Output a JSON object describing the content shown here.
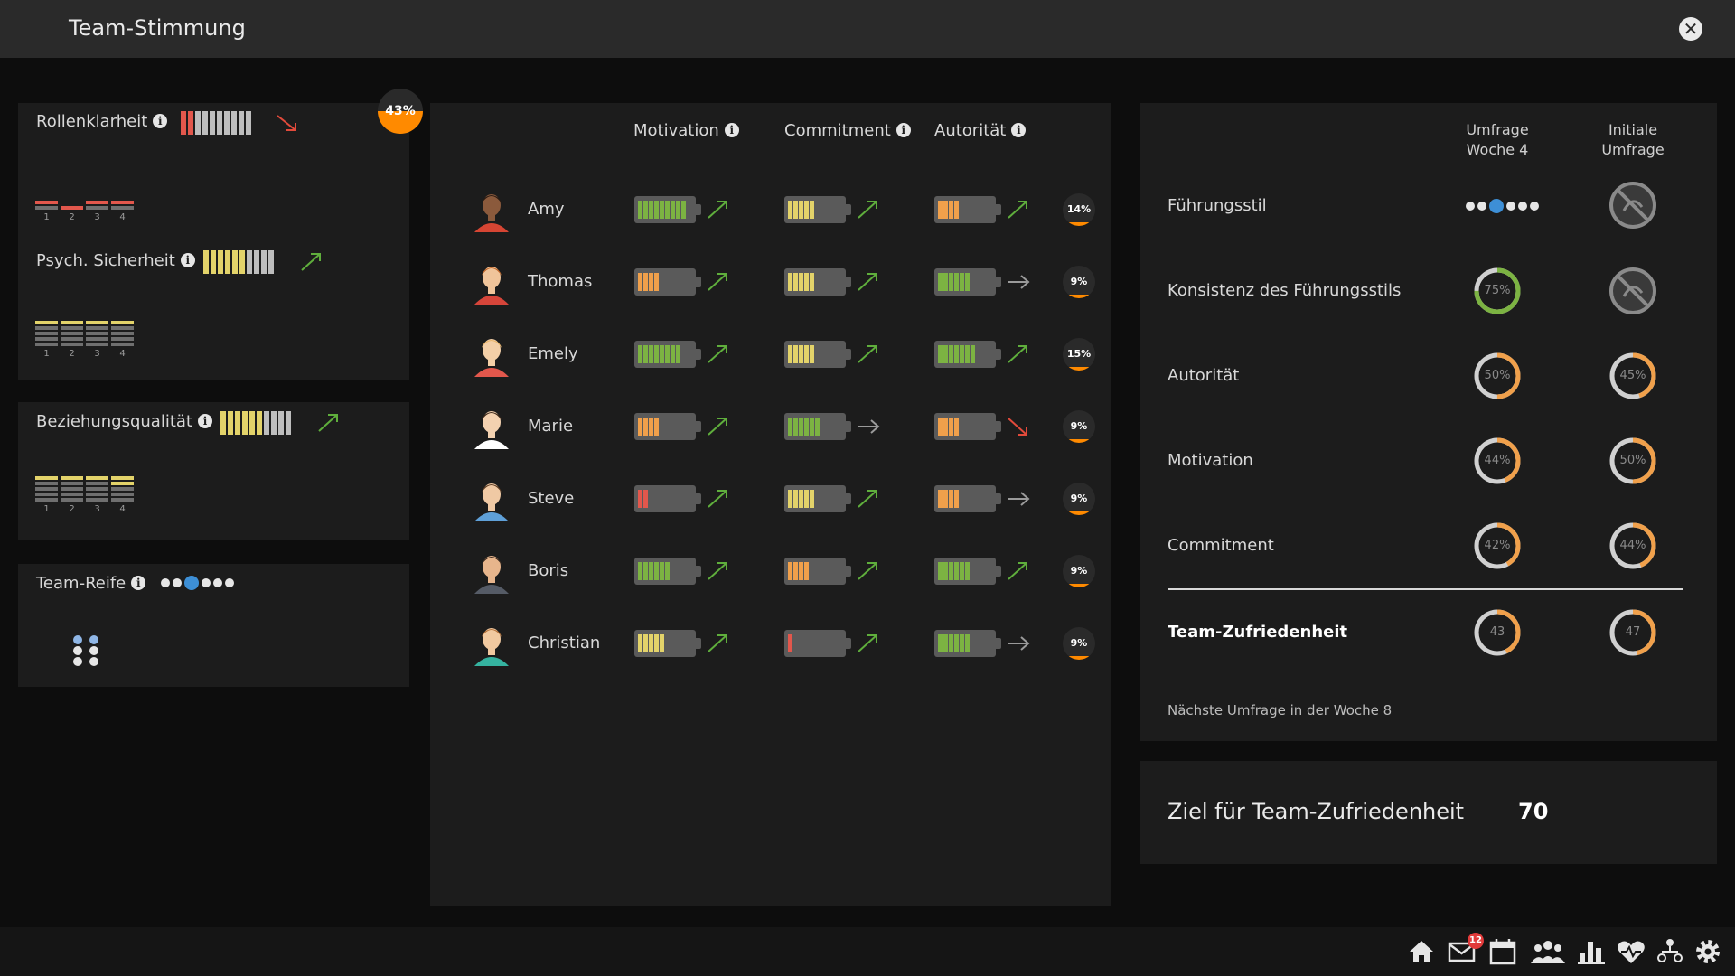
{
  "window": {
    "title": "Team-Stimmung",
    "close_label": "✕"
  },
  "left": {
    "rollenklarheit": {
      "label": "Rollenklarheit",
      "badge": "43%",
      "ticks": [
        "1",
        "2",
        "3",
        "4"
      ],
      "trend": "down"
    },
    "psych": {
      "label": "Psych. Sicherheit",
      "ticks": [
        "1",
        "2",
        "3",
        "4"
      ],
      "trend": "up"
    },
    "beziehung": {
      "label": "Beziehungsqualität",
      "ticks": [
        "1",
        "2",
        "3",
        "4"
      ],
      "trend": "up"
    },
    "reife": {
      "label": "Team-Reife"
    }
  },
  "members": {
    "headers": {
      "motivation": "Motivation",
      "commitment": "Commitment",
      "autoritaet": "Autorität"
    },
    "rows": [
      {
        "name": "Amy",
        "pct": "14%",
        "mot": 9,
        "com": 5,
        "aut": 4,
        "motTrend": "up",
        "comTrend": "up",
        "autTrend": "up"
      },
      {
        "name": "Thomas",
        "pct": "9%",
        "mot": 4,
        "com": 5,
        "aut": 6,
        "motTrend": "up",
        "comTrend": "up",
        "autTrend": "flat"
      },
      {
        "name": "Emely",
        "pct": "15%",
        "mot": 8,
        "com": 5,
        "aut": 7,
        "motTrend": "up",
        "comTrend": "up",
        "autTrend": "up"
      },
      {
        "name": "Marie",
        "pct": "9%",
        "mot": 4,
        "com": 6,
        "aut": 4,
        "motTrend": "up",
        "comTrend": "flat",
        "autTrend": "down"
      },
      {
        "name": "Steve",
        "pct": "9%",
        "mot": 2,
        "com": 5,
        "aut": 4,
        "motTrend": "up",
        "comTrend": "up",
        "autTrend": "flat"
      },
      {
        "name": "Boris",
        "pct": "9%",
        "mot": 6,
        "com": 4,
        "aut": 6,
        "motTrend": "up",
        "comTrend": "up",
        "autTrend": "up"
      },
      {
        "name": "Christian",
        "pct": "9%",
        "mot": 5,
        "com": 1,
        "aut": 6,
        "motTrend": "up",
        "comTrend": "up",
        "autTrend": "flat"
      }
    ]
  },
  "survey": {
    "head_week": "Umfrage\nWoche 4",
    "head_initial": "Initiale\nUmfrage",
    "rows": [
      {
        "label": "Führungsstil",
        "week": "",
        "initial": ""
      },
      {
        "label": "Konsistenz des Führungsstils",
        "week": "75%",
        "week_value": 0.75,
        "initial": ""
      },
      {
        "label": "Autorität",
        "week": "50%",
        "week_value": 0.5,
        "initial": "45%",
        "initial_value": 0.45
      },
      {
        "label": "Motivation",
        "week": "44%",
        "week_value": 0.44,
        "initial": "50%",
        "initial_value": 0.5
      },
      {
        "label": "Commitment",
        "week": "42%",
        "week_value": 0.42,
        "initial": "44%",
        "initial_value": 0.44
      }
    ],
    "satisfaction": {
      "label": "Team-Zufriedenheit",
      "week": "43",
      "week_value": 0.43,
      "initial": "47",
      "initial_value": 0.47
    },
    "next": "Nächste Umfrage in der Woche 8"
  },
  "goal": {
    "label": "Ziel für Team-Zufriedenheit",
    "value": "70"
  },
  "bottom": {
    "mail_count": "12"
  },
  "colors": {
    "green": "#7cb342",
    "yellow": "#e3d36a",
    "orange": "#f0a04b",
    "red": "#e2574c",
    "arrowGreen": "#5fae3c",
    "arrowRed": "#e24a3b",
    "arrowGray": "#9a9a9a"
  }
}
